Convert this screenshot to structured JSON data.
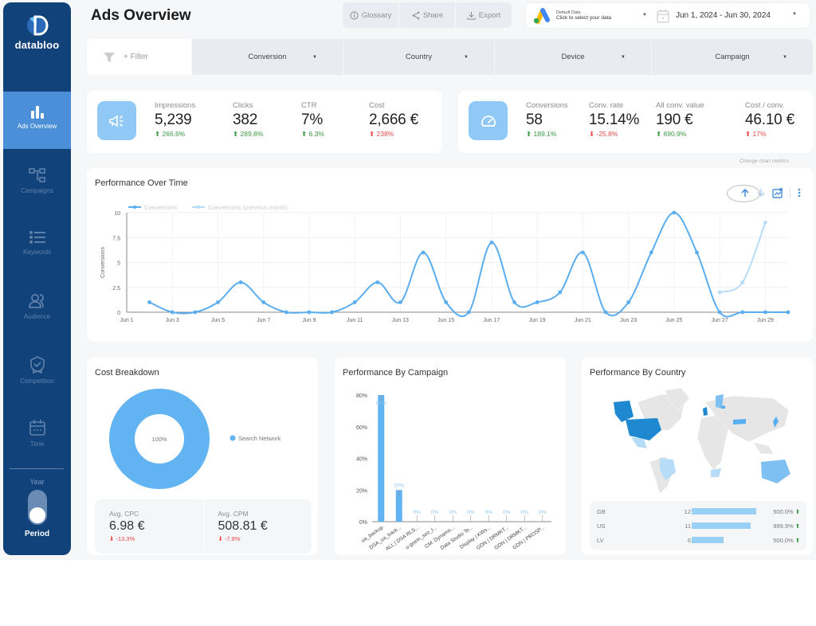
{
  "app": {
    "brand": "databloo",
    "page_title": "Ads Overview"
  },
  "sidebar": {
    "items": [
      {
        "label": "Ads Overview",
        "icon": "bar-chart-icon",
        "active": true
      },
      {
        "label": "Campaigns",
        "icon": "hierarchy-icon",
        "active": false
      },
      {
        "label": "Keywords",
        "icon": "list-icon",
        "active": false
      },
      {
        "label": "Audience",
        "icon": "users-icon",
        "active": false
      },
      {
        "label": "Competition",
        "icon": "badge-icon",
        "active": false
      },
      {
        "label": "Time",
        "icon": "calendar-icon",
        "active": false
      }
    ],
    "toggle_top_label": "Year",
    "toggle_bottom_label": "Period",
    "toggle_state": "Period"
  },
  "header": {
    "actions": [
      {
        "label": "Glossary",
        "icon": "info-icon"
      },
      {
        "label": "Share",
        "icon": "share-icon"
      },
      {
        "label": "Export",
        "icon": "download-icon"
      }
    ],
    "data_source": {
      "small_label": "Default Data",
      "main_label": "Click to select your data"
    },
    "date_range": "Jun 1, 2024 - Jun 30, 2024"
  },
  "filters": {
    "add_label": "+ Filter",
    "dropdowns": [
      "Conversion",
      "Country",
      "Device",
      "Campaign"
    ]
  },
  "kpis_left": [
    {
      "label": "Impressions",
      "value": "5,239",
      "delta": "266.6%",
      "trend": "up"
    },
    {
      "label": "Clicks",
      "value": "382",
      "delta": "289.8%",
      "trend": "up"
    },
    {
      "label": "CTR",
      "value": "7%",
      "delta": "6.3%",
      "trend": "up"
    },
    {
      "label": "Cost",
      "value": "2,666 €",
      "delta": "238%",
      "trend": "up-bad"
    }
  ],
  "kpis_right": [
    {
      "label": "Conversions",
      "value": "58",
      "delta": "189.1%",
      "trend": "up"
    },
    {
      "label": "Conv. rate",
      "value": "15.14%",
      "delta": "-25.8%",
      "trend": "down"
    },
    {
      "label": "All conv. value",
      "value": "190 €",
      "delta": "690.9%",
      "trend": "up"
    },
    {
      "label": "Cost / conv.",
      "value": "46.10 €",
      "delta": "17%",
      "trend": "up-bad"
    }
  ],
  "performance": {
    "title": "Performance Over Time",
    "hint": "Change chart metrics"
  },
  "cost_breakdown": {
    "title": "Cost Breakdown",
    "center_label": "100%",
    "legend": "Search Network",
    "avg_cpc_label": "Avg. CPC",
    "avg_cpc_value": "6.98 €",
    "avg_cpc_delta": "-13.3%",
    "avg_cpm_label": "Avg. CPM",
    "avg_cpm_value": "508.81 €",
    "avg_cpm_delta": "-7.8%"
  },
  "campaign": {
    "title": "Performance By Campaign"
  },
  "country": {
    "title": "Performance By Country",
    "rows": [
      {
        "code": "GB",
        "value": "12",
        "pct": "500.0%"
      },
      {
        "code": "US",
        "value": "11",
        "pct": "999.9%"
      },
      {
        "code": "LV",
        "value": "6",
        "pct": "500.0%"
      }
    ],
    "highlighted": [
      "US",
      "GB",
      "AU",
      "BR",
      "MX",
      "JP",
      "TR",
      "ZA",
      "SE",
      "LV"
    ]
  },
  "colors": {
    "sidebar": "#12427a",
    "active_nav": "#4a8fd8",
    "accent": "#5aaeef",
    "accent_light": "#b6dcf8",
    "positive": "#3a9c42",
    "negative": "#e84a4a"
  },
  "chart_data": [
    {
      "type": "line",
      "title": "Performance Over Time",
      "ylabel": "Conversions",
      "ylim": [
        0,
        10
      ],
      "yticks": [
        "0",
        "2.5",
        "5",
        "7.5",
        "10"
      ],
      "xticks": [
        "Jun 1",
        "Jun 3",
        "Jun 5",
        "Jun 7",
        "Jun 9",
        "Jun 11",
        "Jun 13",
        "Jun 15",
        "Jun 17",
        "Jun 19",
        "Jun 21",
        "Jun 23",
        "Jun 25",
        "Jun 27",
        "Jun 29"
      ],
      "x": [
        1,
        2,
        3,
        4,
        5,
        6,
        7,
        8,
        9,
        10,
        11,
        12,
        13,
        14,
        15,
        16,
        17,
        18,
        19,
        20,
        21,
        22,
        23,
        24,
        25,
        26,
        27,
        28,
        29,
        30
      ],
      "legend_position": "top-left",
      "series": [
        {
          "name": "Conversions",
          "values": [
            null,
            1,
            0,
            0,
            1,
            3,
            1,
            0,
            0,
            0,
            1,
            3,
            1,
            6,
            1,
            0,
            7,
            1,
            1,
            2,
            6,
            0,
            1,
            6,
            10,
            6,
            0,
            0,
            0,
            0
          ]
        },
        {
          "name": "Conversions (previous month)",
          "values": [
            null,
            null,
            null,
            null,
            null,
            null,
            null,
            null,
            null,
            null,
            null,
            null,
            null,
            null,
            null,
            null,
            null,
            null,
            null,
            null,
            null,
            null,
            null,
            null,
            null,
            null,
            2,
            3,
            9,
            null
          ]
        }
      ]
    },
    {
      "type": "pie",
      "title": "Cost Breakdown",
      "categories": [
        "Search Network"
      ],
      "values": [
        100
      ]
    },
    {
      "type": "bar",
      "title": "Performance By Campaign",
      "categories": [
        "ua_backup",
        "DSA_ua_back...",
        "ALL | DSA RLS...",
        "u-gsem_seo_t...",
        "CM: Dynamic...",
        "Data Studio Te...",
        "Display | KWs...",
        "GDN | DRMKT...",
        "GDN | DRMKT...",
        "GDN | PROSP..."
      ],
      "values": [
        80,
        20,
        0,
        0,
        0,
        0,
        0,
        0,
        0,
        0
      ],
      "data_labels": [
        "80%",
        "20%",
        "0%",
        "0%",
        "0%",
        "0%",
        "0%",
        "0%",
        "0%",
        "0%"
      ],
      "yticks": [
        "0%",
        "20%",
        "40%",
        "60%",
        "80%"
      ],
      "ylim": [
        0,
        80
      ]
    }
  ]
}
